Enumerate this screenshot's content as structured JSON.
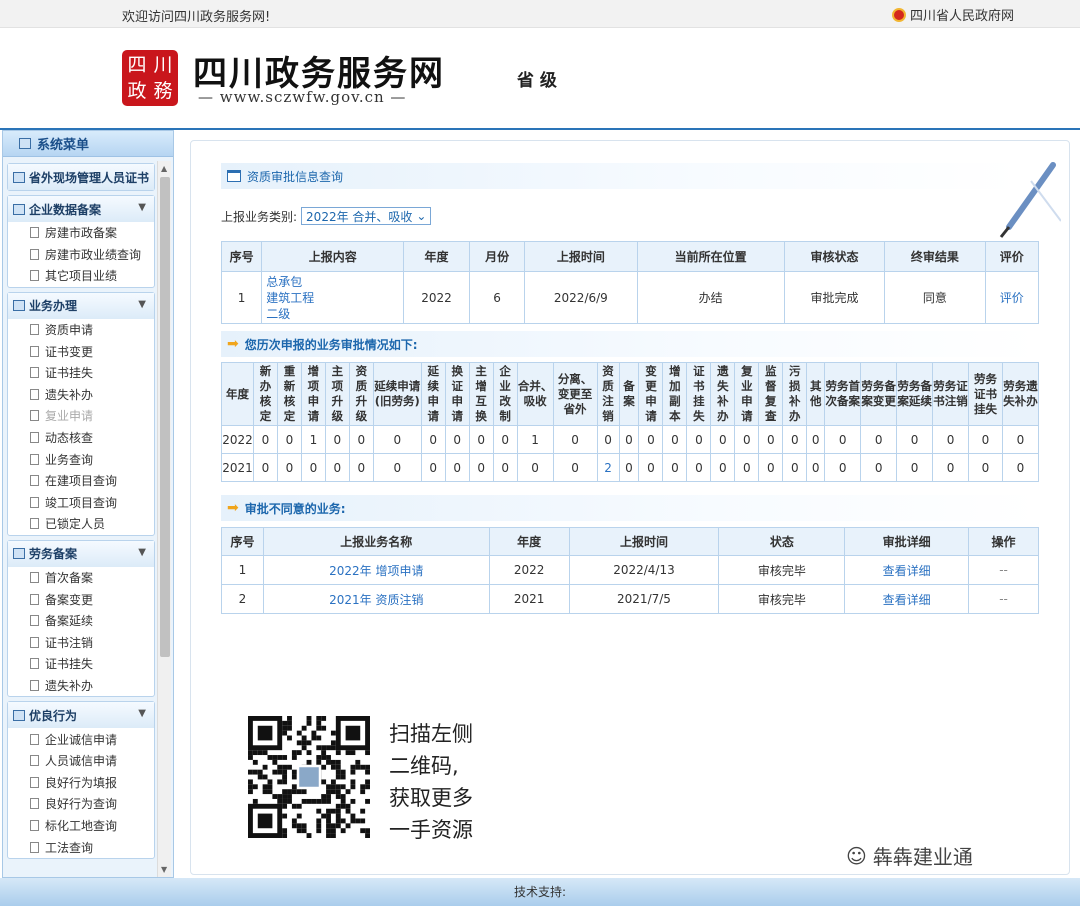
{
  "topbar": {
    "welcome": "欢迎访问四川政务服务网!",
    "gov_link": "四川省人民政府网"
  },
  "header": {
    "seal": [
      "四",
      "川",
      "政",
      "務"
    ],
    "title": "四川政务服务网",
    "url": "— www.sczwfw.gov.cn —",
    "level": "省 级"
  },
  "sidebar": {
    "title": "系统菜单",
    "groups": [
      {
        "title": "省外现场管理人员证书",
        "items": []
      },
      {
        "title": "企业数据备案",
        "items": [
          "房建市政备案",
          "房建市政业绩查询",
          "其它项目业绩"
        ]
      },
      {
        "title": "业务办理",
        "items": [
          "资质申请",
          "证书变更",
          "证书挂失",
          "遗失补办",
          "复业申请",
          "动态核查",
          "业务查询",
          "在建项目查询",
          "竣工项目查询",
          "已锁定人员"
        ]
      },
      {
        "title": "劳务备案",
        "items": [
          "首次备案",
          "备案变更",
          "备案延续",
          "证书注销",
          "证书挂失",
          "遗失补办"
        ]
      },
      {
        "title": "优良行为",
        "items": [
          "企业诚信申请",
          "人员诚信申请",
          "良好行为填报",
          "良好行为查询",
          "标化工地查询",
          "工法查询"
        ]
      }
    ]
  },
  "main": {
    "section1_title": "资质审批信息查询",
    "filter_label": "上报业务类别:",
    "filter_value": "2022年 合并、吸收",
    "table1": {
      "headers": [
        "序号",
        "上报内容",
        "年度",
        "月份",
        "上报时间",
        "当前所在位置",
        "审核状态",
        "终审结果",
        "评价"
      ],
      "row": {
        "no": "1",
        "content": [
          "总承包",
          "建筑工程",
          "二级"
        ],
        "year": "2022",
        "month": "6",
        "time": "2022/6/9",
        "position": "办结",
        "status": "审批完成",
        "result": "同意",
        "eval": "评价"
      }
    },
    "section2_title": "您历次申报的业务审批情况如下:",
    "table2": {
      "headers": [
        "年度",
        "新办核定",
        "重新核定",
        "增项申请",
        "主项升级",
        "资质升级",
        "延续申请(旧劳务)",
        "延续申请",
        "换证申请",
        "主增互换",
        "企业改制",
        "合并、吸收",
        "分离、变更至省外",
        "资质注销",
        "备案",
        "变更申请",
        "增加副本",
        "证书挂失",
        "遗失补办",
        "复业申请",
        "监督复查",
        "污损补办",
        "其他",
        "劳务首次备案",
        "劳务备案变更",
        "劳务备案延续",
        "劳务证书注销",
        "劳务证书挂失",
        "劳务遗失补办"
      ],
      "rows": [
        [
          "2022",
          "0",
          "0",
          "1",
          "0",
          "0",
          "0",
          "0",
          "0",
          "0",
          "0",
          "1",
          "0",
          "0",
          "0",
          "0",
          "0",
          "0",
          "0",
          "0",
          "0",
          "0",
          "0",
          "0",
          "0",
          "0",
          "0",
          "0",
          "0"
        ],
        [
          "2021",
          "0",
          "0",
          "0",
          "0",
          "0",
          "0",
          "0",
          "0",
          "0",
          "0",
          "0",
          "0",
          "2",
          "0",
          "0",
          "0",
          "0",
          "0",
          "0",
          "0",
          "0",
          "0",
          "0",
          "0",
          "0",
          "0",
          "0",
          "0"
        ]
      ]
    },
    "section3_title": "审批不同意的业务:",
    "table3": {
      "headers": [
        "序号",
        "上报业务名称",
        "年度",
        "上报时间",
        "状态",
        "审批详细",
        "操作"
      ],
      "rows": [
        {
          "no": "1",
          "name": "2022年 增项申请",
          "year": "2022",
          "time": "2022/4/13",
          "status": "审核完毕",
          "detail": "查看详细",
          "op": "--"
        },
        {
          "no": "2",
          "name": "2021年 资质注销",
          "year": "2021",
          "time": "2021/7/5",
          "status": "审核完毕",
          "detail": "查看详细",
          "op": "--"
        }
      ]
    },
    "promo": [
      "扫描左侧",
      "二维码,",
      "获取更多",
      "一手资源"
    ],
    "wechat": "犇犇建业通"
  },
  "footer": {
    "text": "技术支持:"
  }
}
